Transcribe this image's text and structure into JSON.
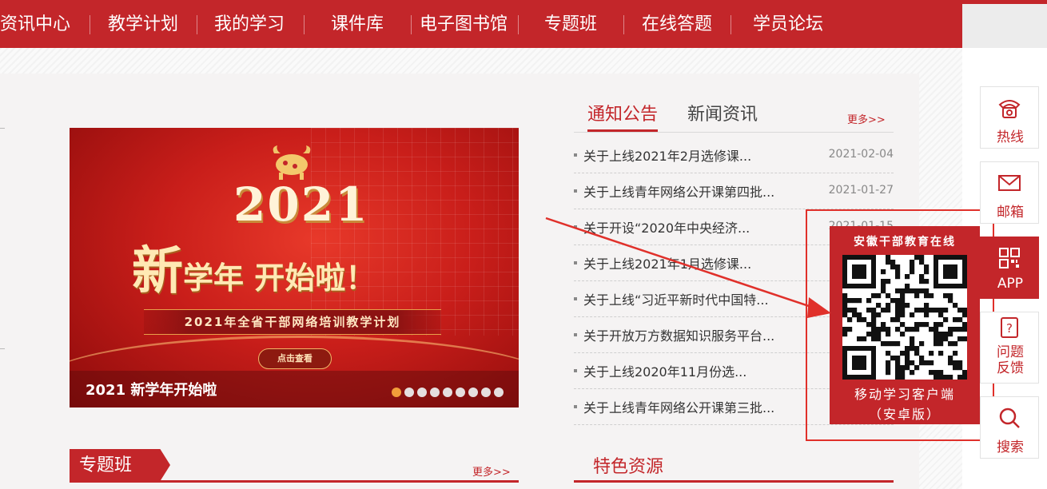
{
  "nav": {
    "items": [
      "资讯中心",
      "教学计划",
      "我的学习",
      "课件库",
      "电子图书馆",
      "专题班",
      "在线答题",
      "学员论坛"
    ]
  },
  "banner": {
    "year": "2021",
    "slogan_big": "新",
    "slogan_rest": "学年 开始啦！",
    "plan_text": "2021年全省干部网络培训教学计划",
    "view_button": "点击查看",
    "caption": "2021 新学年开始啦",
    "slide_count": 9,
    "active_slide": 1
  },
  "notices": {
    "tabs": [
      "通知公告",
      "新闻资讯"
    ],
    "more": "更多>>",
    "items": [
      {
        "title": "关于上线2021年2月选修课...",
        "date": "2021-02-04"
      },
      {
        "title": "关于上线青年网络公开课第四批...",
        "date": "2021-01-27"
      },
      {
        "title": "关于开设“2020年中央经济...",
        "date": "2021-01-15"
      },
      {
        "title": "关于上线2021年1月选修课...",
        "date": ""
      },
      {
        "title": "关于上线“习近平新时代中国特...",
        "date": ""
      },
      {
        "title": "关于开放万方数据知识服务平台...",
        "date": ""
      },
      {
        "title": "关于上线2020年11月份选...",
        "date": ""
      },
      {
        "title": "关于上线青年网络公开课第三批...",
        "date": ""
      }
    ]
  },
  "special": {
    "title": "专题班",
    "more": "更多>>"
  },
  "feature": {
    "title": "特色资源"
  },
  "sidebar": {
    "hotline": "热线",
    "mailbox": "邮箱",
    "app": "APP",
    "feedback_line1": "问题",
    "feedback_line2": "反馈",
    "search": "搜索"
  },
  "qr": {
    "header": "安徽干部教育在线",
    "footer1": "移动学习客户端",
    "footer2": "（安卓版）"
  },
  "colors": {
    "brand_red": "#c3262a",
    "dot_active": "#f29d3a",
    "highlight": "#e0302a"
  }
}
